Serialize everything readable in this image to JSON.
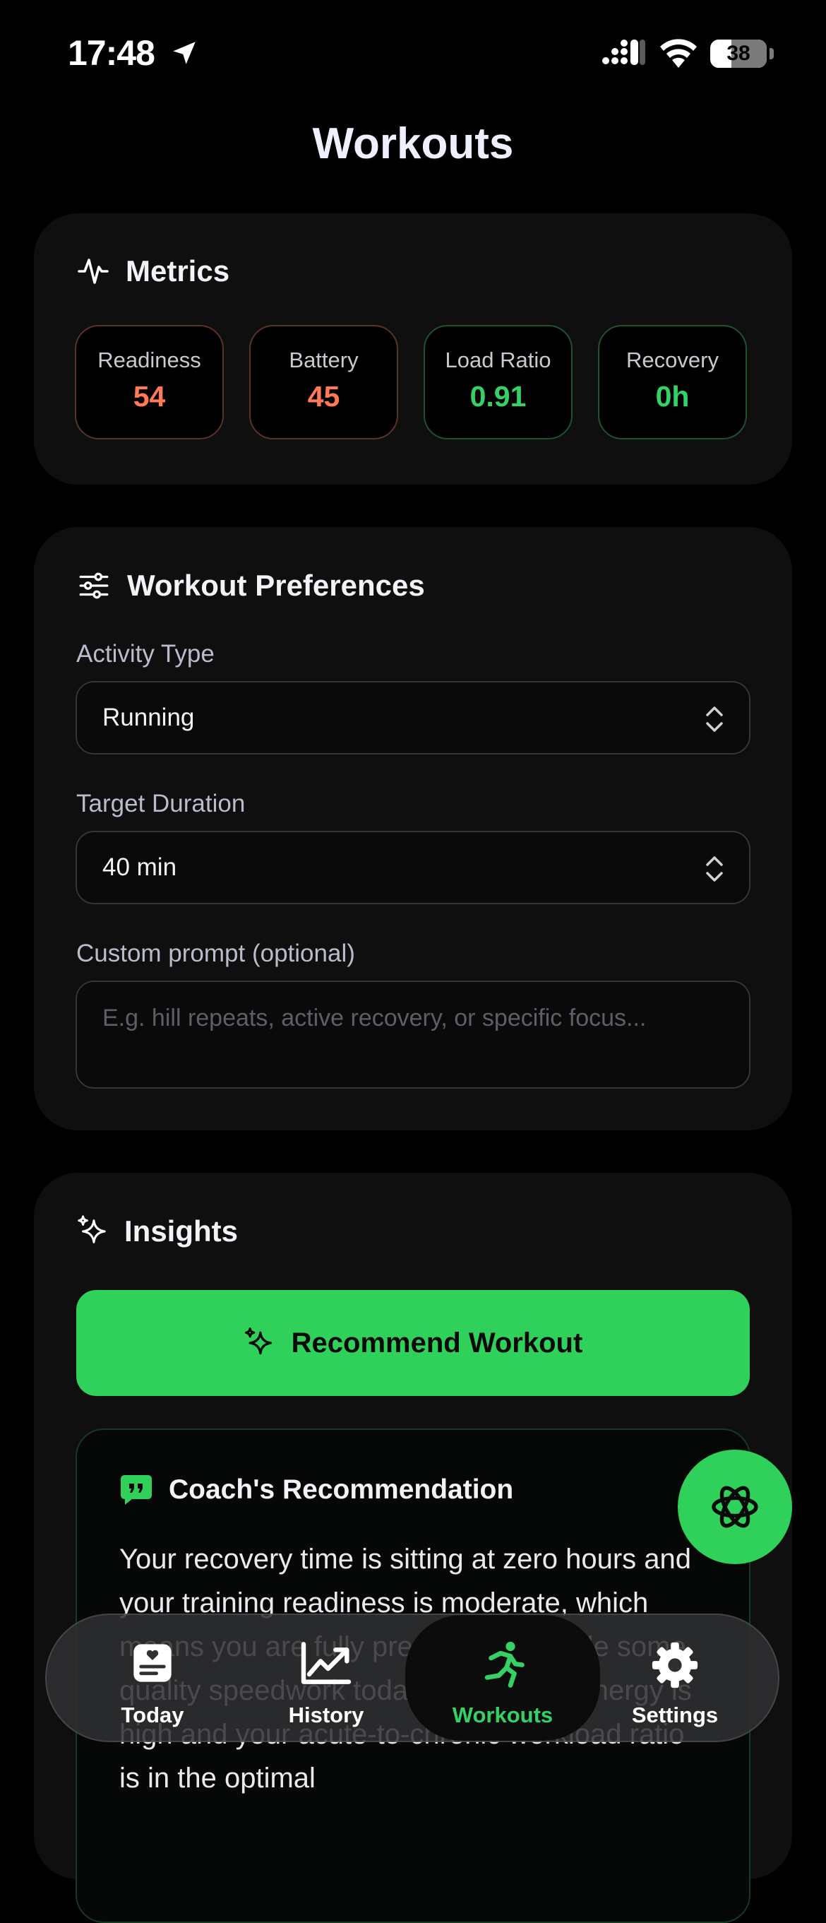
{
  "status": {
    "time": "17:48",
    "battery": "38",
    "battery_level": 0.38
  },
  "page": {
    "title": "Workouts"
  },
  "metrics": {
    "title": "Metrics",
    "items": [
      {
        "label": "Readiness",
        "value": "54"
      },
      {
        "label": "Battery",
        "value": "45"
      },
      {
        "label": "Load Ratio",
        "value": "0.91"
      },
      {
        "label": "Recovery",
        "value": "0h"
      }
    ]
  },
  "preferences": {
    "title": "Workout Preferences",
    "activity_label": "Activity Type",
    "activity_value": "Running",
    "duration_label": "Target Duration",
    "duration_value": "40 min",
    "prompt_label": "Custom prompt (optional)",
    "prompt_placeholder": "E.g. hill repeats, active recovery, or specific focus..."
  },
  "insights": {
    "title": "Insights",
    "recommend_button": "Recommend Workout",
    "recommendation_title": "Coach's Recommendation",
    "recommendation_text": "Your recovery time is sitting at zero hours and your training readiness is moderate, which means you are fully prepared to handle some quality speedwork today. Since your energy is high and your acute-to-chronic workload ratio is in the optimal"
  },
  "colors": {
    "accent": "#2fd15a",
    "warning": "#ff7a55",
    "good": "#34d264"
  },
  "tabs": [
    {
      "label": "Today",
      "icon": "today-card-icon"
    },
    {
      "label": "History",
      "icon": "chart-trend-icon"
    },
    {
      "label": "Workouts",
      "icon": "running-figure-icon",
      "active": true
    },
    {
      "label": "Settings",
      "icon": "gear-icon"
    }
  ]
}
